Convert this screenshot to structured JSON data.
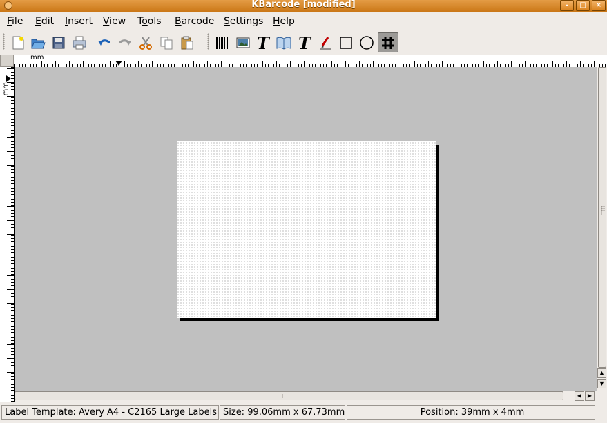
{
  "window": {
    "title": "KBarcode [modified]"
  },
  "menu": {
    "items": [
      {
        "prefix": "",
        "mnemonic": "F",
        "rest": "ile"
      },
      {
        "prefix": "",
        "mnemonic": "E",
        "rest": "dit"
      },
      {
        "prefix": "",
        "mnemonic": "I",
        "rest": "nsert"
      },
      {
        "prefix": "",
        "mnemonic": "V",
        "rest": "iew"
      },
      {
        "prefix": "T",
        "mnemonic": "o",
        "rest": "ols"
      },
      {
        "prefix": "",
        "mnemonic": "B",
        "rest": "arcode"
      },
      {
        "prefix": "",
        "mnemonic": "S",
        "rest": "ettings"
      },
      {
        "prefix": "",
        "mnemonic": "H",
        "rest": "elp"
      }
    ]
  },
  "toolbar": {
    "icons": [
      "new-document-icon",
      "open-folder-icon",
      "save-icon",
      "print-icon",
      "undo-icon",
      "redo-icon",
      "cut-icon",
      "copy-icon",
      "paste-icon",
      "insert-barcode-icon",
      "insert-picture-icon",
      "insert-text-icon",
      "insert-rich-text-icon",
      "insert-text-alt-icon",
      "draw-line-icon",
      "draw-rectangle-icon",
      "draw-ellipse-icon",
      "grid-toggle-icon"
    ]
  },
  "ruler": {
    "unit": "mm"
  },
  "status": {
    "template": "Label Template: Avery A4 - C2165 Large Labels",
    "size": "Size: 99.06mm x 67.73mm",
    "position": "Position: 39mm x 4mm"
  },
  "colors": {
    "titlebar": "#d9831e",
    "canvas": "#c0c0c0",
    "label": "#ffffff"
  }
}
